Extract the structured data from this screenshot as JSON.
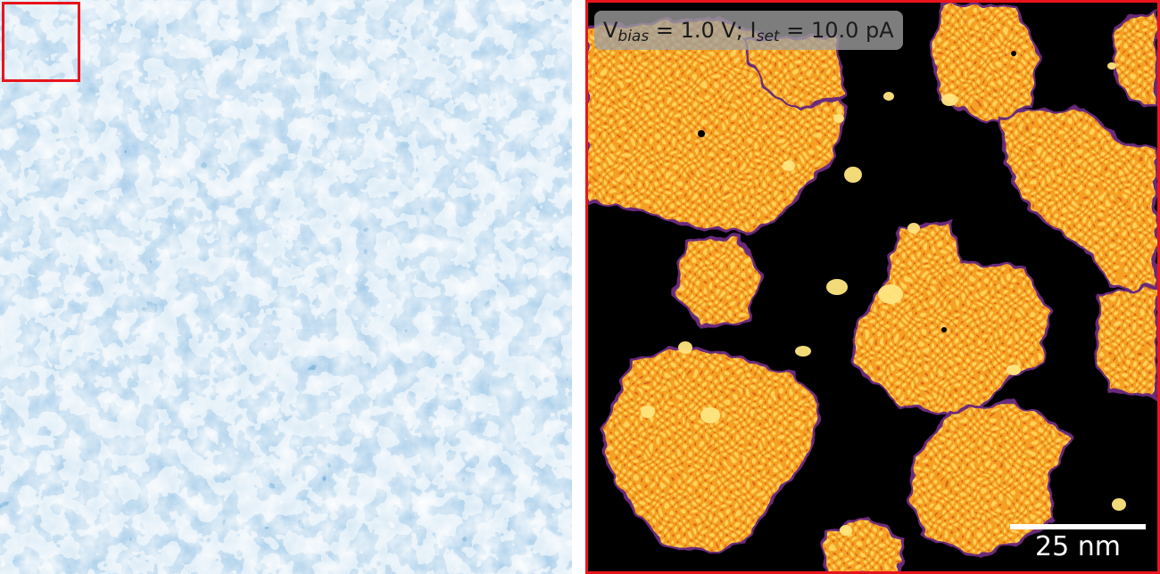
{
  "left_panel": {
    "colormap": [
      "#1b5fa8",
      "#5b97cf",
      "#a9cce8",
      "#dbeaf6"
    ],
    "highlight_color": "#e8151c"
  },
  "right_panel": {
    "colormap": [
      "#000000",
      "#5a1a6a",
      "#e8731c",
      "#f5a623",
      "#ffe98a"
    ],
    "border_color": "#e8151c",
    "params": {
      "v_main": "V",
      "v_sub": "bias",
      "v_value": " = 1.0 V; ",
      "i_main": "I",
      "i_sub": "set",
      "i_value": " = 10.0 pA"
    },
    "scalebar": {
      "label": "25 nm"
    }
  }
}
